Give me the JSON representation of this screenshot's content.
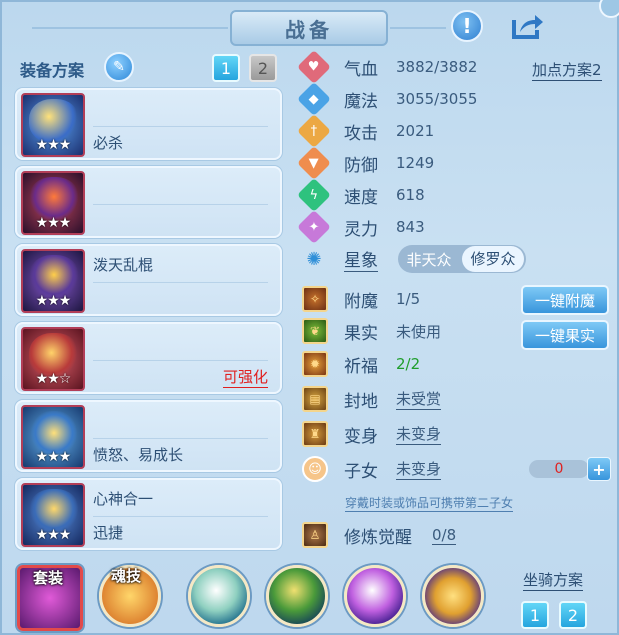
{
  "header": {
    "title": "战备"
  },
  "equip": {
    "title": "装备方案",
    "plan_tabs": [
      "1",
      "2"
    ],
    "items": [
      {
        "top": "",
        "bottom": "必杀",
        "stars": "★★★",
        "color": "#3a6cc8"
      },
      {
        "top": "",
        "bottom": "",
        "stars": "★★★",
        "color": "#6a2b8a"
      },
      {
        "top": "泼天乱棍",
        "bottom": "",
        "stars": "★★★",
        "color": "#5a3a9a"
      },
      {
        "top": "",
        "bottom": "",
        "stars": "★★☆",
        "enhance": "可强化",
        "color": "#b83a3a"
      },
      {
        "top": "",
        "bottom": "愤怒、易成长",
        "stars": "★★★",
        "color": "#3a7ac8"
      },
      {
        "top": "心神合一",
        "bottom": "迅捷",
        "stars": "★★★",
        "color": "#3a6cb8"
      }
    ]
  },
  "stats": {
    "add_plan": "加点方案2",
    "rows": [
      {
        "label": "气血",
        "value": "3882/3882",
        "icon": "heart-icon",
        "color": "#e06a7a"
      },
      {
        "label": "魔法",
        "value": "3055/3055",
        "icon": "mana-icon",
        "color": "#4aa3e6"
      },
      {
        "label": "攻击",
        "value": "2021",
        "icon": "sword-icon",
        "color": "#eca843"
      },
      {
        "label": "防御",
        "value": "1249",
        "icon": "shield-icon",
        "color": "#ef8d4e"
      },
      {
        "label": "速度",
        "value": "618",
        "icon": "speed-icon",
        "color": "#2ec27e"
      },
      {
        "label": "灵力",
        "value": "843",
        "icon": "spirit-icon",
        "color": "#c779d9"
      }
    ],
    "star_label": "星象",
    "star_options": [
      "非天众",
      "修罗众"
    ],
    "enchant": {
      "label": "附魔",
      "value": "1/5",
      "button": "一键附魔"
    },
    "fruit": {
      "label": "果实",
      "value": "未使用",
      "button": "一键果实"
    },
    "bless": {
      "label": "祈福",
      "value": "2/2"
    },
    "seal": {
      "label": "封地",
      "value": "未受赏"
    },
    "transform": {
      "label": "变身",
      "value": "未变身"
    },
    "child": {
      "label": "子女",
      "value": "未变身",
      "count": "0",
      "plus": "+"
    },
    "hint": "穿戴时装或饰品可携带第二子女",
    "cultivate": {
      "label": "修炼觉醒",
      "value": "0/8"
    }
  },
  "bottom": {
    "set_label": "套装",
    "soul_label": "魂技",
    "mount_title": "坐骑方案",
    "mount_tabs": [
      "1",
      "2"
    ]
  },
  "colors": {
    "accent": "#2f8fd8",
    "red": "#e02020",
    "green": "#1f9e2c"
  }
}
